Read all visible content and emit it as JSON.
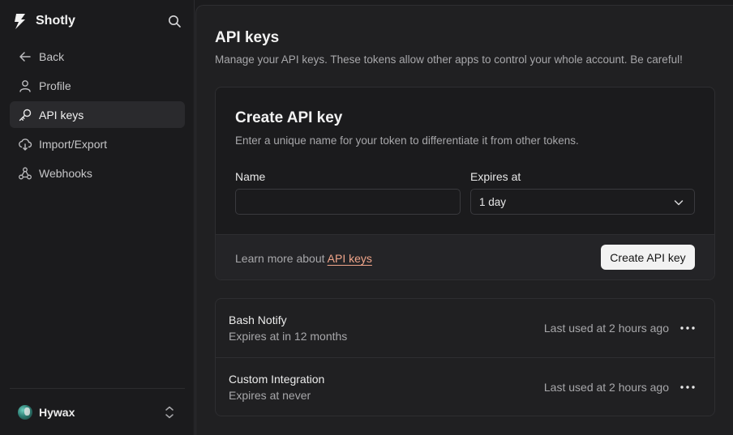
{
  "sidebar": {
    "brand": "Shotly",
    "items": [
      {
        "label": "Back",
        "icon": "arrow-left-icon"
      },
      {
        "label": "Profile",
        "icon": "user-icon"
      },
      {
        "label": "API keys",
        "icon": "key-icon",
        "active": true
      },
      {
        "label": "Import/Export",
        "icon": "cloud-sync-icon"
      },
      {
        "label": "Webhooks",
        "icon": "webhook-icon"
      }
    ],
    "user": {
      "name": "Hywax"
    }
  },
  "main": {
    "title": "API keys",
    "subtitle": "Manage your API keys. These tokens allow other apps to control your whole account. Be careful!",
    "create_card": {
      "title": "Create API key",
      "subtitle": "Enter a unique name for your token to differentiate it from other tokens.",
      "name_label": "Name",
      "name_value": "",
      "expires_label": "Expires at",
      "expires_value": "1 day",
      "learn_prefix": "Learn more about",
      "learn_link": "API keys",
      "create_button": "Create API key"
    },
    "keys": [
      {
        "name": "Bash Notify",
        "expires": "Expires at in 12 months",
        "last_used": "Last used at 2 hours ago"
      },
      {
        "name": "Custom Integration",
        "expires": "Expires at never",
        "last_used": "Last used at 2 hours ago"
      }
    ]
  },
  "colors": {
    "accent_link": "#f0a58a",
    "background": "#1b1b1d",
    "panel": "#202022"
  }
}
